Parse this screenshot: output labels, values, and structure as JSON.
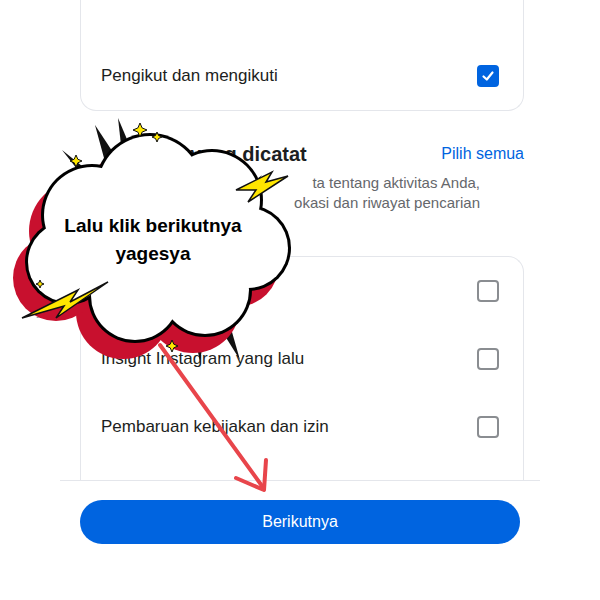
{
  "settings_card": {
    "rows": [
      {
        "label": "Pengikut dan mengikuti",
        "checked": true
      }
    ]
  },
  "section": {
    "title": "yang dicatat",
    "select_all": "Pilih semua",
    "description": [
      "ta tentang aktivitas Anda,",
      "okasi dan riwayat pencarian"
    ],
    "rows": [
      {
        "label": "",
        "checked": false
      },
      {
        "label": "Insight Instagram yang lalu",
        "checked": false
      },
      {
        "label": "Pembaruan kebijakan dan izin",
        "checked": false
      }
    ]
  },
  "next_button": {
    "label": "Berikutnya"
  },
  "callout": {
    "text": "Lalu klik berikutnya yagesya"
  }
}
